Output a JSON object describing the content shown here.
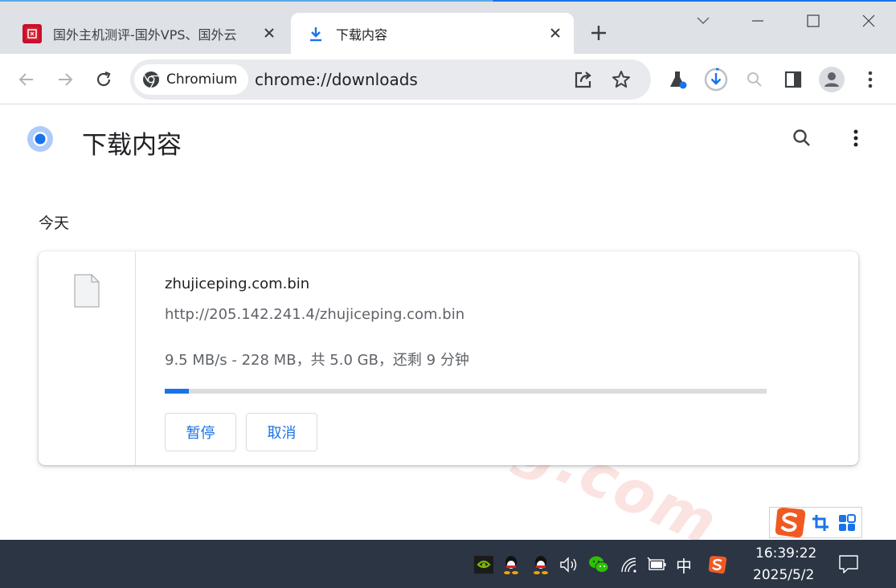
{
  "tabs": [
    {
      "title": "国外主机测评-国外VPS、国外云"
    },
    {
      "title": "下载内容"
    }
  ],
  "toolbar": {
    "chip_label": "Chromium",
    "url": "chrome://downloads"
  },
  "page": {
    "title": "下载内容",
    "section_date": "今天"
  },
  "watermark": "zhujiceping.com",
  "download": {
    "file_name": "zhujiceping.com.bin",
    "url": "http://205.142.241.4/zhujiceping.com.bin",
    "status": "9.5 MB/s - 228 MB，共 5.0 GB，还剩 9 分钟",
    "progress_fraction": 0.04,
    "pause_label": "暂停",
    "cancel_label": "取消"
  },
  "taskbar": {
    "ime_mode": "中",
    "time": "16:39:22",
    "date": "2025/5/2"
  },
  "colors": {
    "accent": "#1a73e8",
    "taskbar": "#2b3544",
    "tab_strip": "#dee1e6"
  }
}
